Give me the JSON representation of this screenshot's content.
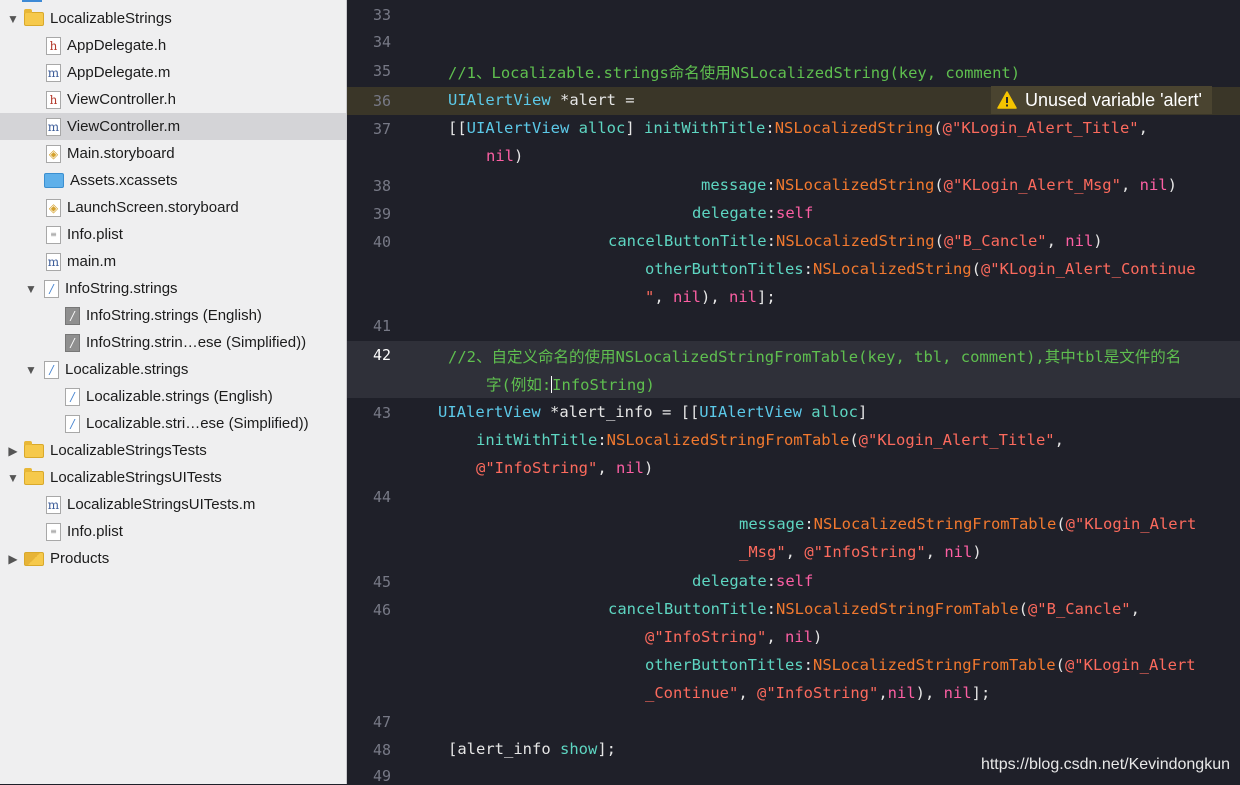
{
  "navigator": {
    "items": [
      {
        "label": "LocalizableStrings",
        "icon": "folder-icon",
        "disclosure": "open"
      },
      {
        "label": "AppDelegate.h",
        "icon": "h-file-icon"
      },
      {
        "label": "AppDelegate.m",
        "icon": "m-file-icon"
      },
      {
        "label": "ViewController.h",
        "icon": "h-file-icon"
      },
      {
        "label": "ViewController.m",
        "icon": "m-file-icon",
        "selected": true
      },
      {
        "label": "Main.storyboard",
        "icon": "storyboard-icon"
      },
      {
        "label": "Assets.xcassets",
        "icon": "assets-icon"
      },
      {
        "label": "LaunchScreen.storyboard",
        "icon": "storyboard-icon"
      },
      {
        "label": "Info.plist",
        "icon": "plist-icon"
      },
      {
        "label": "main.m",
        "icon": "m-file-icon"
      },
      {
        "label": "InfoString.strings",
        "icon": "strings-file-icon",
        "disclosure": "open"
      },
      {
        "label": "InfoString.strings (English)",
        "icon": "strings-file-icon"
      },
      {
        "label": "InfoString.strin…ese (Simplified))",
        "icon": "strings-file-icon"
      },
      {
        "label": "Localizable.strings",
        "icon": "strings-file-icon",
        "disclosure": "open"
      },
      {
        "label": "Localizable.strings (English)",
        "icon": "strings-file-icon"
      },
      {
        "label": "Localizable.stri…ese (Simplified))",
        "icon": "strings-file-icon"
      },
      {
        "label": "LocalizableStringsTests",
        "icon": "folder-icon",
        "disclosure": "closed"
      },
      {
        "label": "LocalizableStringsUITests",
        "icon": "folder-icon",
        "disclosure": "open"
      },
      {
        "label": "LocalizableStringsUITests.m",
        "icon": "m-file-icon"
      },
      {
        "label": "Info.plist",
        "icon": "plist-icon"
      },
      {
        "label": "Products",
        "icon": "products-folder-icon",
        "disclosure": "closed"
      }
    ]
  },
  "editor": {
    "line_numbers": [
      "33",
      "34",
      "35",
      "36",
      "37",
      "38",
      "39",
      "40",
      "41",
      "42",
      "43",
      "44",
      "45",
      "46",
      "47",
      "48",
      "49"
    ],
    "current_line": "42",
    "warning_line": "36",
    "code": {
      "l35": "//1、Localizable.strings命名使用NSLocalizedString(key, comment)",
      "l36_type": "UIAlertView",
      "l36_rest": " *alert =",
      "l37_a": "[[",
      "l37_b": "UIAlertView",
      "l37_c": " ",
      "l37_d": "alloc",
      "l37_e": "] ",
      "l37_f": "initWithTitle",
      "l37_g": ":",
      "l37_h": "NSLocalizedString",
      "l37_i": "(",
      "l37_j": "@\"KLogin_Alert_Title\"",
      "l37_k": ",",
      "l37w_nil": "nil",
      "l37w_close": ")",
      "l38_a": "message",
      "l38_b": ":",
      "l38_c": "NSLocalizedString",
      "l38_d": "(",
      "l38_e": "@\"KLogin_Alert_Msg\"",
      "l38_f": ", ",
      "l38_g": "nil",
      "l38_h": ")",
      "l39_a": "delegate",
      "l39_b": ":",
      "l39_c": "self",
      "l40_a": "cancelButtonTitle",
      "l40_b": ":",
      "l40_c": "NSLocalizedString",
      "l40_d": "(",
      "l40_e": "@\"B_Cancle\"",
      "l40_f": ", ",
      "l40_g": "nil",
      "l40_h": ")",
      "l40w_a": "otherButtonTitles",
      "l40w_b": ":",
      "l40w_c": "NSLocalizedString",
      "l40w_d": "(",
      "l40w_e": "@\"KLogin_Alert_Continue",
      "l40w2_a": "\"",
      "l40w2_b": ", ",
      "l40w2_c": "nil",
      "l40w2_d": "), ",
      "l40w2_e": "nil",
      "l40w2_f": "];",
      "l42_a": "//2、自定义命名的使用NSLocalizedStringFromTable(key, tbl, comment),其中tbl是文件的名",
      "l42w_a": "字(例如:",
      "l42w_b": "InfoString)",
      "l43_a": "UIAlertView",
      "l43_b": " *alert_info = [[",
      "l43_c": "UIAlertView",
      "l43_d": " ",
      "l43_e": "alloc",
      "l43_f": "]",
      "l43w_a": "initWithTitle",
      "l43w_b": ":",
      "l43w_c": "NSLocalizedStringFromTable",
      "l43w_d": "(",
      "l43w_e": "@\"KLogin_Alert_Title\"",
      "l43w_f": ",",
      "l43w2_a": "@\"InfoString\"",
      "l43w2_b": ", ",
      "l43w2_c": "nil",
      "l43w2_d": ")",
      "l44w_a": "message",
      "l44w_b": ":",
      "l44w_c": "NSLocalizedStringFromTable",
      "l44w_d": "(",
      "l44w_e": "@\"KLogin_Alert",
      "l44w2_a": "_Msg\"",
      "l44w2_b": ", ",
      "l44w2_c": "@\"InfoString\"",
      "l44w2_d": ", ",
      "l44w2_e": "nil",
      "l44w2_f": ")",
      "l45_a": "delegate",
      "l45_b": ":",
      "l45_c": "self",
      "l46_a": "cancelButtonTitle",
      "l46_b": ":",
      "l46_c": "NSLocalizedStringFromTable",
      "l46_d": "(",
      "l46_e": "@\"B_Cancle\"",
      "l46_f": ",",
      "l46w_a": "@\"InfoString\"",
      "l46w_b": ", ",
      "l46w_c": "nil",
      "l46w_d": ")",
      "l46w2_a": "otherButtonTitles",
      "l46w2_b": ":",
      "l46w2_c": "NSLocalizedStringFromTable",
      "l46w2_d": "(",
      "l46w2_e": "@\"KLogin_Alert",
      "l46w3_a": "_Continue\"",
      "l46w3_b": ", ",
      "l46w3_c": "@\"InfoString\"",
      "l46w3_d": ",",
      "l46w3_e": "nil",
      "l46w3_f": "), ",
      "l46w3_g": "nil",
      "l46w3_h": "];",
      "l48_a": "[alert_info ",
      "l48_b": "show",
      "l48_c": "];"
    },
    "warning": {
      "text": "Unused variable 'alert'",
      "icon": "warning-triangle-icon"
    }
  },
  "watermark": "https://blog.csdn.net/Kevindongkun",
  "colors": {
    "editor_bg": "#1f2029",
    "comment": "#5fbf4f",
    "type": "#5cc9e8",
    "method": "#5ed6c2",
    "macro": "#f2792f",
    "string": "#fc6a5d",
    "keyword": "#fc5fa3",
    "warning": "#f5c400"
  }
}
